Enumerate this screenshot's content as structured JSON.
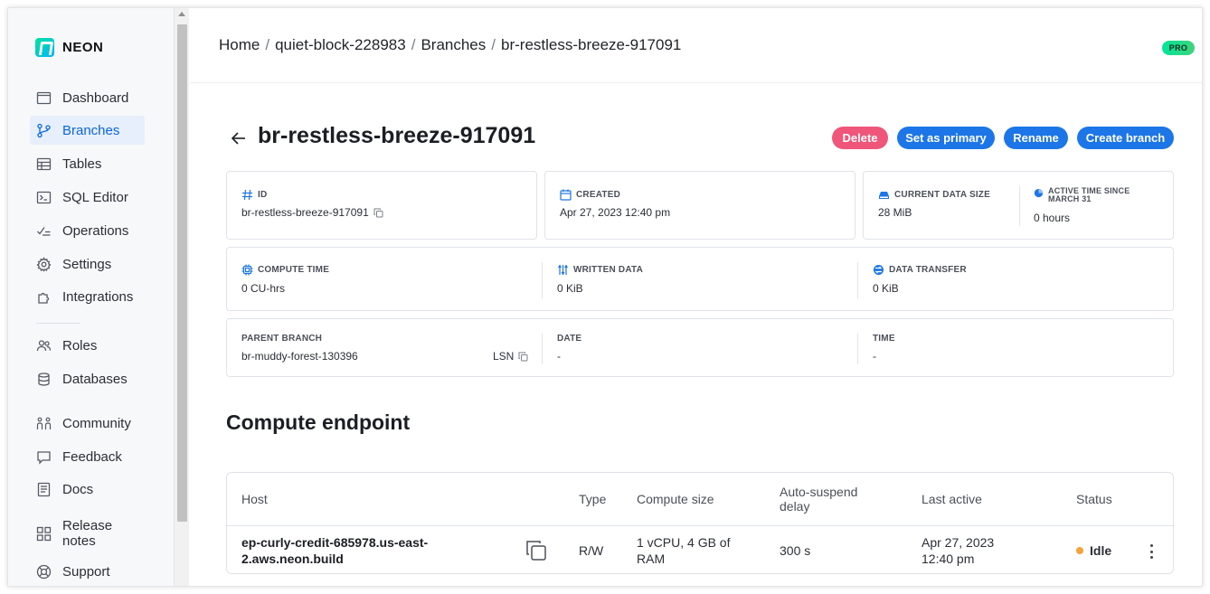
{
  "app": {
    "logo_text": "NEON",
    "plan_badge": "PRO",
    "accent_color": "#1c76e8",
    "danger_color": "#f0557a",
    "brand_gradient": [
      "#00e599",
      "#00b3ff"
    ]
  },
  "sidebar": {
    "items": [
      {
        "label": "Dashboard",
        "icon": "dashboard-icon"
      },
      {
        "label": "Branches",
        "icon": "branch-icon",
        "active": true
      },
      {
        "label": "Tables",
        "icon": "table-icon"
      },
      {
        "label": "SQL Editor",
        "icon": "terminal-icon"
      },
      {
        "label": "Operations",
        "icon": "operations-icon"
      },
      {
        "label": "Settings",
        "icon": "gear-icon"
      },
      {
        "label": "Integrations",
        "icon": "puzzle-icon"
      },
      {
        "label": "Roles",
        "icon": "users-icon"
      },
      {
        "label": "Databases",
        "icon": "database-icon"
      },
      {
        "label": "Community",
        "icon": "community-icon"
      },
      {
        "label": "Feedback",
        "icon": "chat-bubble-icon"
      },
      {
        "label": "Docs",
        "icon": "document-icon"
      },
      {
        "label": "Release\nnotes",
        "icon": "grid-icon"
      },
      {
        "label": "Support",
        "icon": "lifebuoy-icon"
      }
    ]
  },
  "breadcrumb": {
    "home": "Home",
    "project": "quiet-block-228983",
    "section": "Branches",
    "current": "br-restless-breeze-917091",
    "separator": "/"
  },
  "page": {
    "title": "br-restless-breeze-917091"
  },
  "actions": {
    "delete": "Delete",
    "set_primary": "Set as primary",
    "rename": "Rename",
    "create_branch": "Create branch"
  },
  "details": {
    "id": {
      "label": "ID",
      "value": "br-restless-breeze-917091"
    },
    "created": {
      "label": "CREATED",
      "value": "Apr 27, 2023 12:40 pm"
    },
    "data_size": {
      "label": "CURRENT DATA SIZE",
      "value": "28 MiB"
    },
    "active_time": {
      "label": "ACTIVE TIME SINCE MARCH 31",
      "value": "0 hours"
    },
    "compute_time": {
      "label": "COMPUTE TIME",
      "value": "0 CU-hrs"
    },
    "written_data": {
      "label": "WRITTEN DATA",
      "value": "0 KiB"
    },
    "data_transfer": {
      "label": "DATA TRANSFER",
      "value": "0 KiB"
    },
    "parent_branch": {
      "label": "PARENT BRANCH",
      "value": "br-muddy-forest-130396",
      "lsn_label": "LSN"
    },
    "date": {
      "label": "DATE",
      "value": "-"
    },
    "time": {
      "label": "TIME",
      "value": "-"
    }
  },
  "compute": {
    "title": "Compute endpoint",
    "columns": [
      "Host",
      "Type",
      "Compute size",
      "Auto-suspend delay",
      "Last active",
      "Status"
    ],
    "rows": [
      {
        "host": "ep-curly-credit-685978.us-east-2.aws.neon.build",
        "type": "R/W",
        "compute_size": "1 vCPU, 4 GB of RAM",
        "auto_suspend": "300 s",
        "last_active": "Apr 27, 2023 12:40 pm",
        "status": "Idle",
        "status_color": "#f5a23a"
      }
    ]
  }
}
